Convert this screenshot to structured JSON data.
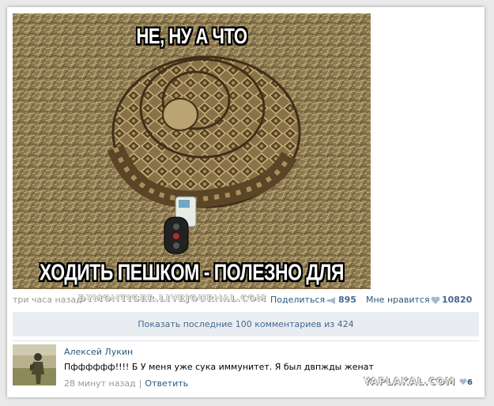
{
  "image": {
    "top_caption": "НЕ, НУ А ЧТО",
    "bottom_caption": "ХОДИТЬ ПЕШКОМ - ПОЛЕЗНО ДЛЯ ЗДОРОВЬЯ"
  },
  "meta": {
    "time": "три часа назад",
    "source_watermark": "DYMONTIGER.LIVEJOURNAL.COM",
    "share_label": "Поделиться",
    "share_count": "895",
    "like_label": "Мне нравится",
    "like_count": "10820"
  },
  "comments_bar": {
    "label": "Показать последние 100 комментариев из 424"
  },
  "comment": {
    "author": "Алексей Лукин",
    "text": "Пфффффф!!!! Б У меня уже сука иммунитет. Я был двпжды женат",
    "time": "28 минут назад",
    "reply_label": "Ответить",
    "like_badge": "6"
  },
  "site_watermark": "YAPLAKAL.COM",
  "colors": {
    "link": "#2b587a",
    "muted": "#999999",
    "bar_bg": "#e9edf1"
  }
}
